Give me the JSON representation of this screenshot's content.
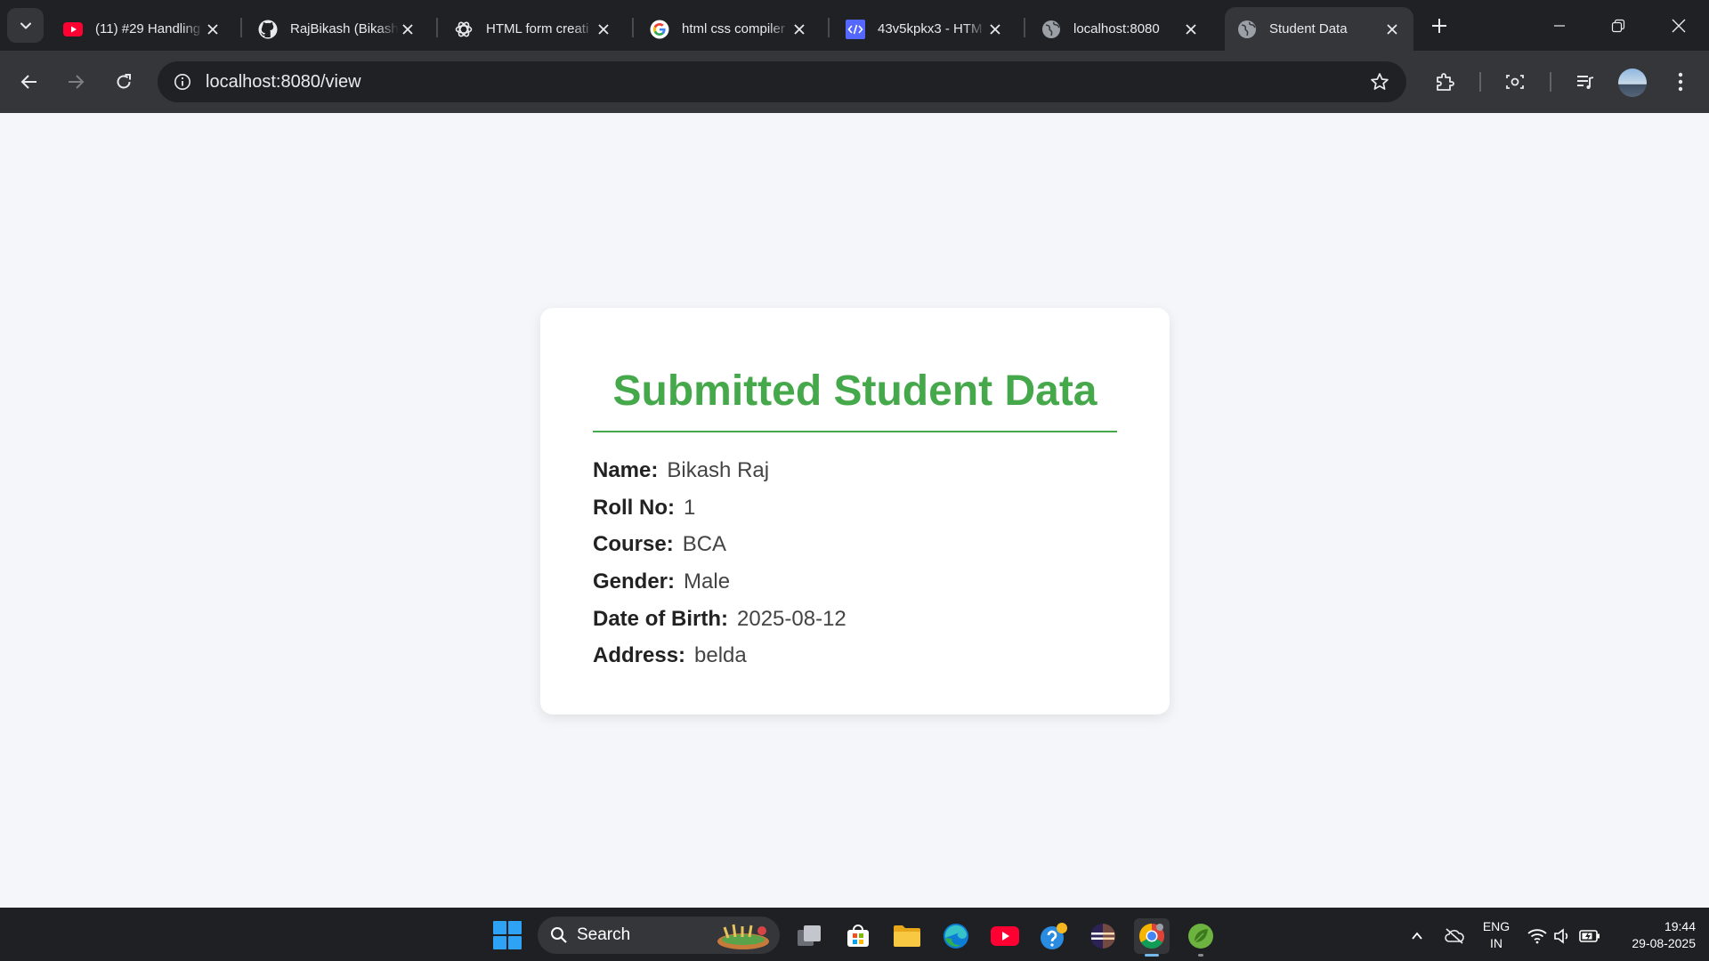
{
  "browser": {
    "tabs": [
      {
        "title": "(11) #29 Handling",
        "icon": "youtube-icon"
      },
      {
        "title": "RajBikash (Bikash",
        "icon": "github-icon"
      },
      {
        "title": "HTML form creati",
        "icon": "chatgpt-icon"
      },
      {
        "title": "html css compiler",
        "icon": "google-icon"
      },
      {
        "title": "43v5kpkx3 - HTM",
        "icon": "code-icon"
      },
      {
        "title": "localhost:8080",
        "icon": "globe-icon"
      },
      {
        "title": "Student Data",
        "icon": "globe-icon",
        "active": true
      }
    ],
    "url": "localhost:8080/view"
  },
  "page": {
    "heading": "Submitted Student Data",
    "fields": [
      {
        "label": "Name:",
        "value": "Bikash Raj"
      },
      {
        "label": "Roll No:",
        "value": "1"
      },
      {
        "label": "Course:",
        "value": "BCA"
      },
      {
        "label": "Gender:",
        "value": "Male"
      },
      {
        "label": "Date of Birth:",
        "value": "2025-08-12"
      },
      {
        "label": "Address:",
        "value": "belda"
      }
    ],
    "accent_color": "#45a84a"
  },
  "taskbar": {
    "search_label": "Search",
    "language": "ENG",
    "region": "IN",
    "time": "19:44",
    "date": "29-08-2025"
  }
}
